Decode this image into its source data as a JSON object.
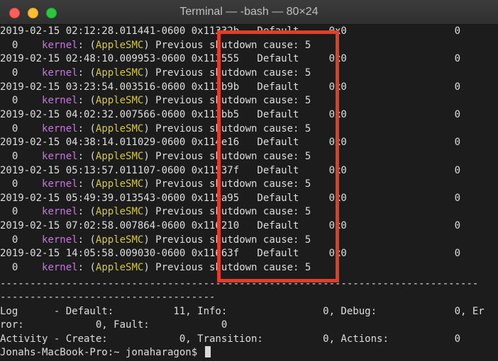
{
  "window": {
    "title": "Terminal — -bash — 80×24"
  },
  "log_rows": [
    {
      "line1": "2019-02-15 02:12:28.011441-0600 0x11332b   Default     0x0                  0",
      "line2_pre": "  0    ",
      "kernel": "kernel",
      "mid": ": (",
      "apple": "AppleSMC",
      "line2_post": ") Previous shutdown cause: 5"
    },
    {
      "line1": "2019-02-15 02:48:10.009953-0600 0x113555   Default     0x0                  0",
      "line2_pre": "  0    ",
      "kernel": "kernel",
      "mid": ": (",
      "apple": "AppleSMC",
      "line2_post": ") Previous shutdown cause: 5"
    },
    {
      "line1": "2019-02-15 03:23:54.003516-0600 0x113b9b   Default     0x0                  0",
      "line2_pre": "  0    ",
      "kernel": "kernel",
      "mid": ": (",
      "apple": "AppleSMC",
      "line2_post": ") Previous shutdown cause: 5"
    },
    {
      "line1": "2019-02-15 04:02:32.007566-0600 0x113bb5   Default     0x0                  0",
      "line2_pre": "  0    ",
      "kernel": "kernel",
      "mid": ": (",
      "apple": "AppleSMC",
      "line2_post": ") Previous shutdown cause: 5"
    },
    {
      "line1": "2019-02-15 04:38:14.011029-0600 0x114e16   Default     0x0                  0",
      "line2_pre": "  0    ",
      "kernel": "kernel",
      "mid": ": (",
      "apple": "AppleSMC",
      "line2_post": ") Previous shutdown cause: 5"
    },
    {
      "line1": "2019-02-15 05:13:57.011107-0600 0x11537f   Default     0x0                  0",
      "line2_pre": "  0    ",
      "kernel": "kernel",
      "mid": ": (",
      "apple": "AppleSMC",
      "line2_post": ") Previous shutdown cause: 5"
    },
    {
      "line1": "2019-02-15 05:49:39.013543-0600 0x115a95   Default     0x0                  0",
      "line2_pre": "  0    ",
      "kernel": "kernel",
      "mid": ": (",
      "apple": "AppleSMC",
      "line2_post": ") Previous shutdown cause: 5"
    },
    {
      "line1": "2019-02-15 07:02:58.007864-0600 0x116210   Default     0x0                  0",
      "line2_pre": "  0    ",
      "kernel": "kernel",
      "mid": ": (",
      "apple": "AppleSMC",
      "line2_post": ") Previous shutdown cause: 5"
    },
    {
      "line1": "2019-02-15 14:05:58.009030-0600 0x11663f   Default     0x0                  0",
      "line2_pre": "  0    ",
      "kernel": "kernel",
      "mid": ": (",
      "apple": "AppleSMC",
      "line2_post": ") Previous shutdown cause: 5"
    }
  ],
  "footer": {
    "separator1": "--------------------------------------------------------------------------------",
    "separator2": "------------------------------------",
    "log_line": "Log      - Default:          11, Info:                0, Debug:             0, Er",
    "ror_line": "ror:            0, Fault:            0",
    "activity_line": "Activity - Create:            0, Transition:          0, Actions:           0",
    "prompt": "Jonahs-MacBook-Pro:~ jonaharagon$ "
  }
}
